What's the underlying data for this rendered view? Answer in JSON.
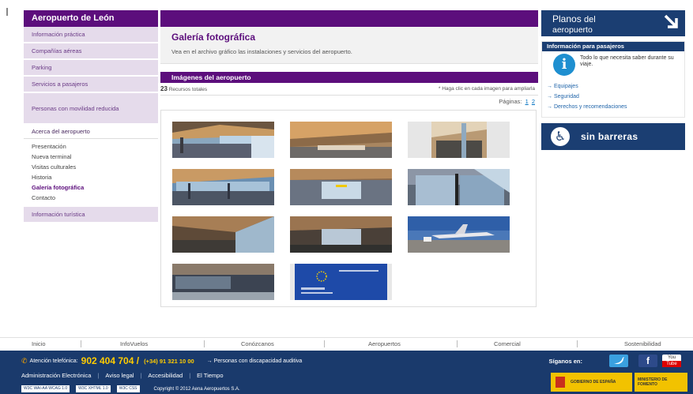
{
  "sidebar": {
    "title": "Aeropuerto de León",
    "items": [
      {
        "label": "Información práctica"
      },
      {
        "label": "Compañías aéreas"
      },
      {
        "label": "Parking"
      },
      {
        "label": "Servicios a pasajeros"
      },
      {
        "label": "Personas con movilidad reducida"
      },
      {
        "label": "Acerca del aeropuerto"
      }
    ],
    "subitems": [
      {
        "label": "Presentación"
      },
      {
        "label": "Nueva terminal"
      },
      {
        "label": "Visitas culturales"
      },
      {
        "label": "Historia"
      },
      {
        "label": "Galería fotográfica"
      },
      {
        "label": "Contacto"
      }
    ],
    "after_item": "Información turística"
  },
  "main": {
    "title": "Galería fotográfica",
    "description": "Vea en el archivo gráfico las instalaciones y servicios del aeropuerto.",
    "section_title": "Imágenes del aeropuerto",
    "resource_count": "23",
    "resource_label": "Recursos totales",
    "hint": "* Haga clic en cada imagen para ampliarla",
    "pages_label": "Páginas:",
    "pages": [
      "1",
      "2"
    ]
  },
  "right": {
    "planos_line1": "Planos",
    "planos_line1b": "del",
    "planos_line2": "aeropuerto",
    "info_title": "Información para pasajeros",
    "info_text": "Todo lo que necesita saber durante su viaje.",
    "links": [
      "Equipajes",
      "Seguridad",
      "Derechos y recomendaciones"
    ],
    "sin_barreras": "sin barreras"
  },
  "footer": {
    "nav": [
      "Inicio",
      "InfoVuelos",
      "Conózcanos",
      "Aeropuertos",
      "Comercial",
      "Sostenibilidad"
    ],
    "phone_label": "Atención telefónica:",
    "phone": "902 404 704 /",
    "phone2": "(+34) 91 321 10 00",
    "deaf": "→  Personas con discapacidad auditiva",
    "follow": "Síganos en:",
    "youtube_top": "You",
    "youtube_bottom": "Tube",
    "links": [
      "Administración Electrónica",
      "Aviso legal",
      "Accesibilidad",
      "El Tiempo"
    ],
    "badges": [
      "W3C WAI-AA WCAG 1.0",
      "W3C XHTML 1.0",
      "W3C CSS"
    ],
    "copyright": "Copyright © 2012 Aena Aeropuertos S.A.",
    "gov1": "GOBIERNO DE ESPAÑA",
    "gov2": "MINISTERIO DE FOMENTO"
  },
  "colors": {
    "aena_purple": "#5c0e7c",
    "nav_bg": "#e5dbeb",
    "navy": "#1b3e72",
    "footer_navy": "#1a3a6c",
    "phone_yellow": "#ffcc00"
  }
}
